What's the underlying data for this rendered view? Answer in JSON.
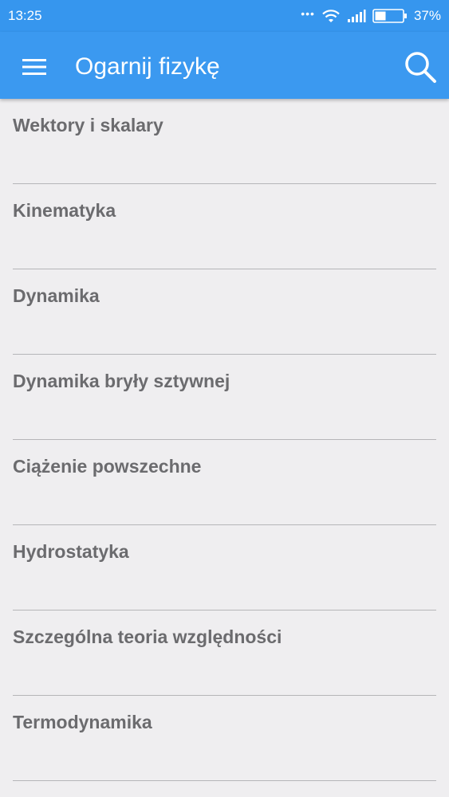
{
  "status_bar": {
    "time": "13:25",
    "battery_percent": "37%",
    "icons": [
      "more-dots-icon",
      "wifi-icon",
      "signal-icon",
      "battery-icon"
    ]
  },
  "app_bar": {
    "title": "Ogarnij fizykę",
    "background": "#3b99f0",
    "icons": [
      "menu-icon",
      "search-icon"
    ]
  },
  "topics": [
    {
      "label": "Wektory i skalary"
    },
    {
      "label": "Kinematyka"
    },
    {
      "label": "Dynamika"
    },
    {
      "label": "Dynamika bryły sztywnej"
    },
    {
      "label": "Ciążenie powszechne"
    },
    {
      "label": "Hydrostatyka"
    },
    {
      "label": "Szczególna teoria względności"
    },
    {
      "label": "Termodynamika"
    }
  ],
  "colors": {
    "accent": "#3b99f0",
    "background": "#efeef0",
    "item_text": "#6b6b6e",
    "divider": "#b5b5b8"
  }
}
